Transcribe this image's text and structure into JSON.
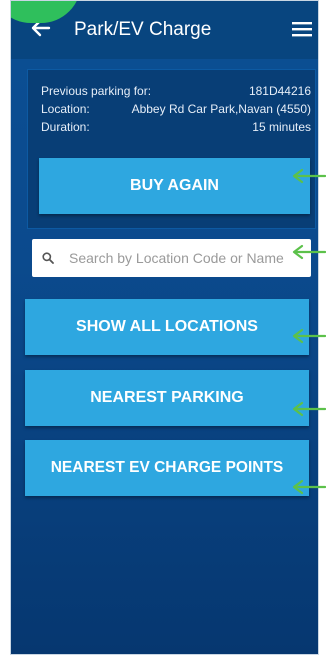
{
  "header": {
    "title": "Park/EV Charge",
    "back_icon": "back-arrow-icon",
    "menu_icon": "hamburger-menu-icon"
  },
  "previous_parking": {
    "label": "Previous parking for:",
    "plate": "181D44216",
    "location_label": "Location:",
    "location_value": "Abbey Rd Car Park,Navan (4550)",
    "duration_label": "Duration:",
    "duration_value": "15 minutes"
  },
  "buttons": {
    "buy_again": "BUY AGAIN",
    "show_all_locations": "SHOW ALL LOCATIONS",
    "nearest_parking": "NEAREST PARKING",
    "nearest_ev": "NEAREST EV CHARGE POINTS"
  },
  "search": {
    "placeholder": "Search by Location Code or Name",
    "value": ""
  },
  "colors": {
    "background": "#0b4f94",
    "header": "#08457f",
    "button": "#2ea7e0",
    "panel": "#083e76",
    "annotation_arrow": "#5cc14a",
    "badge": "#2fbf5c"
  }
}
